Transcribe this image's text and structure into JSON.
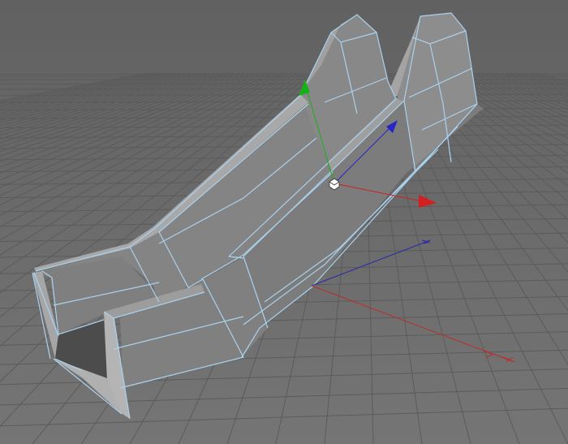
{
  "app": {
    "view": "3D viewport"
  },
  "viewport": {
    "background_color": "#6c6c6c",
    "grid_color": "#5b5b5b",
    "mesh_face_light": "#8f8f8f",
    "mesh_face_mid": "#7d7d7d",
    "mesh_face_dark": "#6e6e6e",
    "mesh_top_color": "#a2a2a2",
    "mesh_inner_color": "#4e4e4e",
    "wire_color": "#a9d2ee",
    "gizmo": {
      "x_axis_color": "#d02020",
      "y_axis_color": "#18b018",
      "z_axis_color": "#2626c8",
      "pivot_icon": "cube-pivot-icon"
    },
    "world_axes": {
      "x_axis_color": "#c02a2a",
      "z_axis_color": "#2a2aa8"
    }
  }
}
